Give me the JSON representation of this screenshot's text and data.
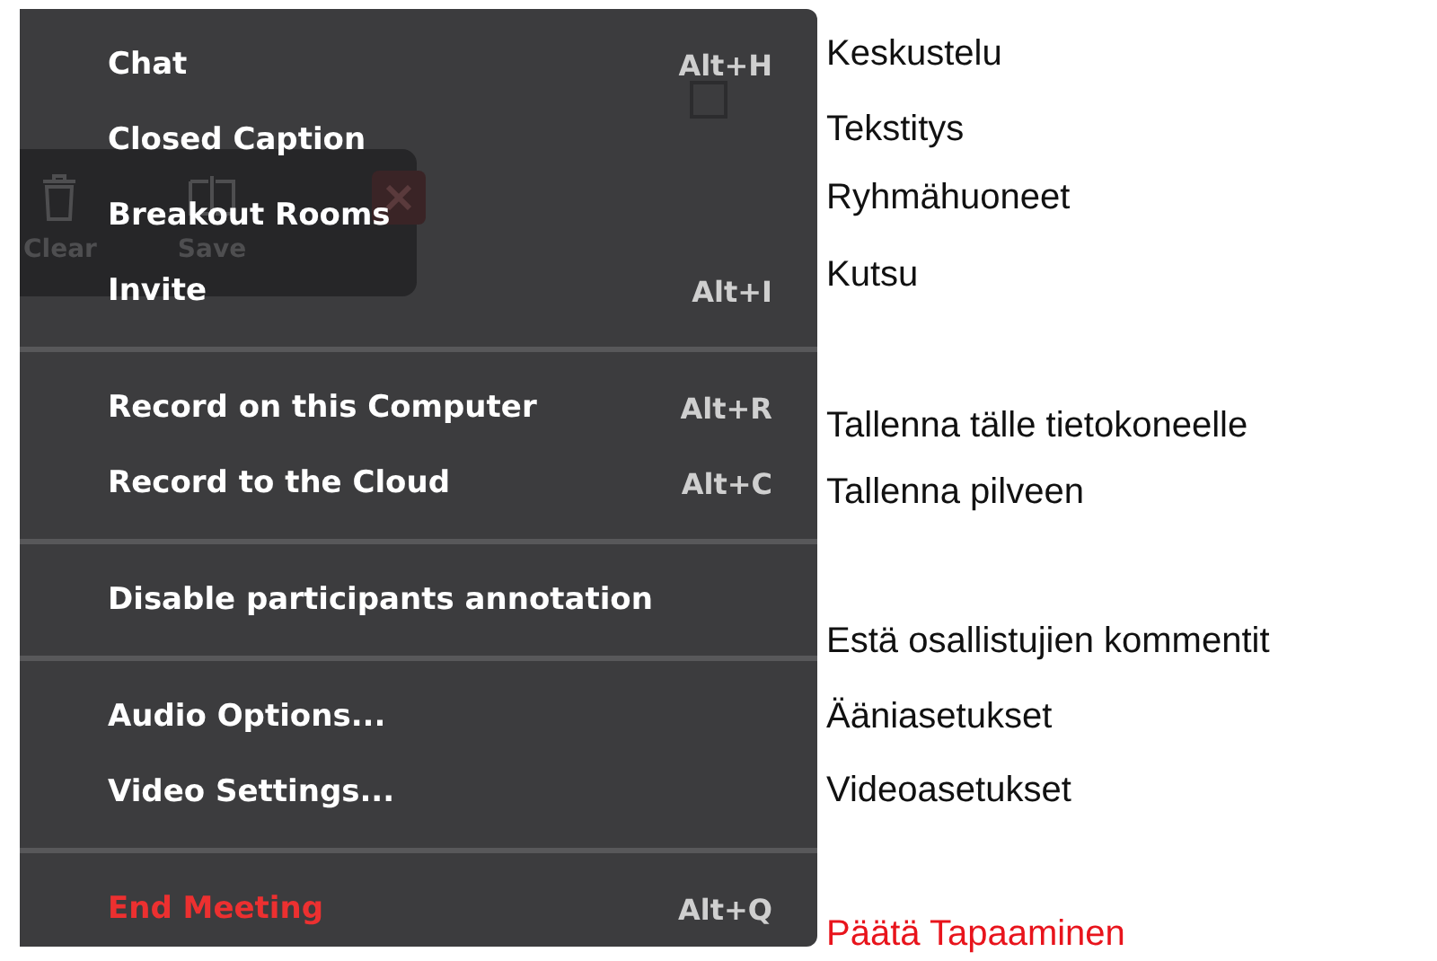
{
  "menu": {
    "checkbox": {
      "checked": false
    },
    "background_toolbar": {
      "buttons": [
        {
          "label": "Clear"
        },
        {
          "label": "Save"
        }
      ]
    },
    "sections": [
      [
        {
          "label": "Chat",
          "shortcut": "Alt+H",
          "kind": "normal"
        },
        {
          "label": "Closed Caption",
          "kind": "normal"
        },
        {
          "label": "Breakout Rooms",
          "kind": "normal"
        },
        {
          "label": "Invite",
          "shortcut": "Alt+I",
          "kind": "normal"
        }
      ],
      [
        {
          "label": "Record on this Computer",
          "shortcut": "Alt+R",
          "kind": "normal"
        },
        {
          "label": "Record to the Cloud",
          "shortcut": "Alt+C",
          "kind": "normal"
        }
      ],
      [
        {
          "label": "Disable participants annotation",
          "kind": "normal"
        }
      ],
      [
        {
          "label": "Audio Options...",
          "kind": "normal"
        },
        {
          "label": "Video Settings...",
          "kind": "normal"
        }
      ],
      [
        {
          "label": "End Meeting",
          "shortcut": "Alt+Q",
          "kind": "danger"
        }
      ]
    ]
  },
  "translations": [
    {
      "text": "Keskustelu",
      "kind": "normal"
    },
    {
      "text": "Tekstitys",
      "kind": "normal"
    },
    {
      "text": "Ryhmähuoneet",
      "kind": "normal"
    },
    {
      "text": "Kutsu",
      "kind": "normal"
    },
    {
      "text": "Tallenna tälle tietokoneelle",
      "kind": "normal"
    },
    {
      "text": "Tallenna pilveen",
      "kind": "normal"
    },
    {
      "text": "Estä osallistujien kommentit",
      "kind": "normal"
    },
    {
      "text": "Ääniasetukset",
      "kind": "normal"
    },
    {
      "text": "Videoasetukset",
      "kind": "normal"
    },
    {
      "text": "Päätä Tapaaminen",
      "kind": "danger"
    }
  ]
}
